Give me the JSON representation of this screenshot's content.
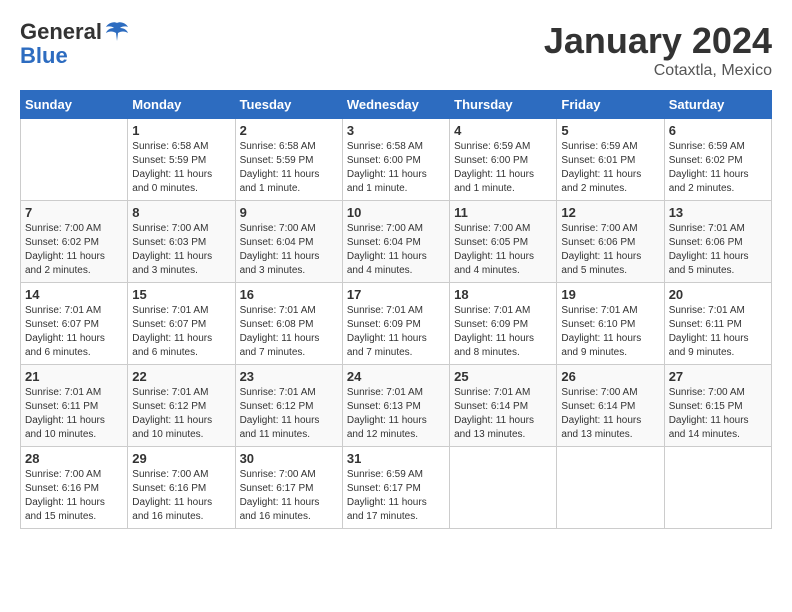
{
  "header": {
    "logo_general": "General",
    "logo_blue": "Blue",
    "month_year": "January 2024",
    "location": "Cotaxtla, Mexico"
  },
  "days_of_week": [
    "Sunday",
    "Monday",
    "Tuesday",
    "Wednesday",
    "Thursday",
    "Friday",
    "Saturday"
  ],
  "weeks": [
    [
      {
        "day": "",
        "info": ""
      },
      {
        "day": "1",
        "info": "Sunrise: 6:58 AM\nSunset: 5:59 PM\nDaylight: 11 hours\nand 0 minutes."
      },
      {
        "day": "2",
        "info": "Sunrise: 6:58 AM\nSunset: 5:59 PM\nDaylight: 11 hours\nand 1 minute."
      },
      {
        "day": "3",
        "info": "Sunrise: 6:58 AM\nSunset: 6:00 PM\nDaylight: 11 hours\nand 1 minute."
      },
      {
        "day": "4",
        "info": "Sunrise: 6:59 AM\nSunset: 6:00 PM\nDaylight: 11 hours\nand 1 minute."
      },
      {
        "day": "5",
        "info": "Sunrise: 6:59 AM\nSunset: 6:01 PM\nDaylight: 11 hours\nand 2 minutes."
      },
      {
        "day": "6",
        "info": "Sunrise: 6:59 AM\nSunset: 6:02 PM\nDaylight: 11 hours\nand 2 minutes."
      }
    ],
    [
      {
        "day": "7",
        "info": "Sunrise: 7:00 AM\nSunset: 6:02 PM\nDaylight: 11 hours\nand 2 minutes."
      },
      {
        "day": "8",
        "info": "Sunrise: 7:00 AM\nSunset: 6:03 PM\nDaylight: 11 hours\nand 3 minutes."
      },
      {
        "day": "9",
        "info": "Sunrise: 7:00 AM\nSunset: 6:04 PM\nDaylight: 11 hours\nand 3 minutes."
      },
      {
        "day": "10",
        "info": "Sunrise: 7:00 AM\nSunset: 6:04 PM\nDaylight: 11 hours\nand 4 minutes."
      },
      {
        "day": "11",
        "info": "Sunrise: 7:00 AM\nSunset: 6:05 PM\nDaylight: 11 hours\nand 4 minutes."
      },
      {
        "day": "12",
        "info": "Sunrise: 7:00 AM\nSunset: 6:06 PM\nDaylight: 11 hours\nand 5 minutes."
      },
      {
        "day": "13",
        "info": "Sunrise: 7:01 AM\nSunset: 6:06 PM\nDaylight: 11 hours\nand 5 minutes."
      }
    ],
    [
      {
        "day": "14",
        "info": "Sunrise: 7:01 AM\nSunset: 6:07 PM\nDaylight: 11 hours\nand 6 minutes."
      },
      {
        "day": "15",
        "info": "Sunrise: 7:01 AM\nSunset: 6:07 PM\nDaylight: 11 hours\nand 6 minutes."
      },
      {
        "day": "16",
        "info": "Sunrise: 7:01 AM\nSunset: 6:08 PM\nDaylight: 11 hours\nand 7 minutes."
      },
      {
        "day": "17",
        "info": "Sunrise: 7:01 AM\nSunset: 6:09 PM\nDaylight: 11 hours\nand 7 minutes."
      },
      {
        "day": "18",
        "info": "Sunrise: 7:01 AM\nSunset: 6:09 PM\nDaylight: 11 hours\nand 8 minutes."
      },
      {
        "day": "19",
        "info": "Sunrise: 7:01 AM\nSunset: 6:10 PM\nDaylight: 11 hours\nand 9 minutes."
      },
      {
        "day": "20",
        "info": "Sunrise: 7:01 AM\nSunset: 6:11 PM\nDaylight: 11 hours\nand 9 minutes."
      }
    ],
    [
      {
        "day": "21",
        "info": "Sunrise: 7:01 AM\nSunset: 6:11 PM\nDaylight: 11 hours\nand 10 minutes."
      },
      {
        "day": "22",
        "info": "Sunrise: 7:01 AM\nSunset: 6:12 PM\nDaylight: 11 hours\nand 10 minutes."
      },
      {
        "day": "23",
        "info": "Sunrise: 7:01 AM\nSunset: 6:12 PM\nDaylight: 11 hours\nand 11 minutes."
      },
      {
        "day": "24",
        "info": "Sunrise: 7:01 AM\nSunset: 6:13 PM\nDaylight: 11 hours\nand 12 minutes."
      },
      {
        "day": "25",
        "info": "Sunrise: 7:01 AM\nSunset: 6:14 PM\nDaylight: 11 hours\nand 13 minutes."
      },
      {
        "day": "26",
        "info": "Sunrise: 7:00 AM\nSunset: 6:14 PM\nDaylight: 11 hours\nand 13 minutes."
      },
      {
        "day": "27",
        "info": "Sunrise: 7:00 AM\nSunset: 6:15 PM\nDaylight: 11 hours\nand 14 minutes."
      }
    ],
    [
      {
        "day": "28",
        "info": "Sunrise: 7:00 AM\nSunset: 6:16 PM\nDaylight: 11 hours\nand 15 minutes."
      },
      {
        "day": "29",
        "info": "Sunrise: 7:00 AM\nSunset: 6:16 PM\nDaylight: 11 hours\nand 16 minutes."
      },
      {
        "day": "30",
        "info": "Sunrise: 7:00 AM\nSunset: 6:17 PM\nDaylight: 11 hours\nand 16 minutes."
      },
      {
        "day": "31",
        "info": "Sunrise: 6:59 AM\nSunset: 6:17 PM\nDaylight: 11 hours\nand 17 minutes."
      },
      {
        "day": "",
        "info": ""
      },
      {
        "day": "",
        "info": ""
      },
      {
        "day": "",
        "info": ""
      }
    ]
  ]
}
